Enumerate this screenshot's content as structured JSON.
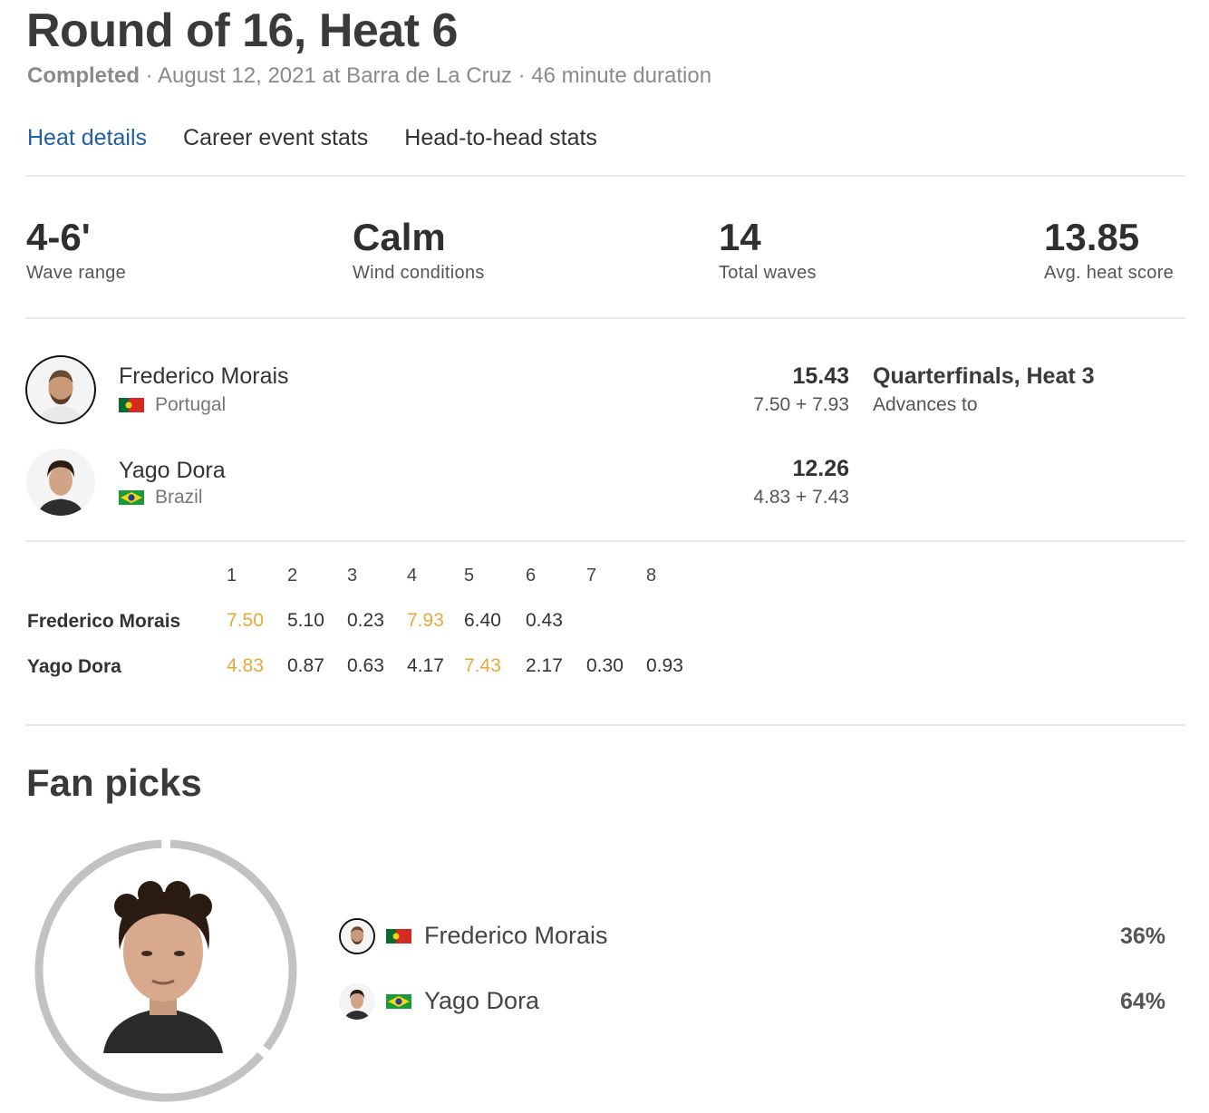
{
  "header": {
    "title": "Round of 16, Heat 6",
    "status": "Completed",
    "details": " · August 12, 2021 at Barra de La Cruz · 46 minute duration"
  },
  "tabs": [
    {
      "label": "Heat details",
      "active": true
    },
    {
      "label": "Career event stats",
      "active": false
    },
    {
      "label": "Head-to-head stats",
      "active": false
    }
  ],
  "stats": {
    "wave_range": {
      "value": "4-6'",
      "label": "Wave range"
    },
    "wind": {
      "value": "Calm",
      "label": "Wind conditions"
    },
    "total_waves": {
      "value": "14",
      "label": "Total waves"
    },
    "avg_score": {
      "value": "13.85",
      "label": "Avg. heat score"
    }
  },
  "athletes": [
    {
      "name": "Frederico Morais",
      "country": "Portugal",
      "flag": "portugal-flag",
      "total": "15.43",
      "breakdown": "7.50 + 7.93",
      "advances_title": "Quarterfinals, Heat 3",
      "advances_label": "Advances to"
    },
    {
      "name": "Yago Dora",
      "country": "Brazil",
      "flag": "brazil-flag",
      "total": "12.26",
      "breakdown": "4.83 + 7.43"
    }
  ],
  "waves": {
    "headers": [
      "1",
      "2",
      "3",
      "4",
      "5",
      "6",
      "7",
      "8"
    ],
    "rows": [
      {
        "name": "Frederico Morais",
        "scores": [
          "7.50",
          "5.10",
          "0.23",
          "7.93",
          "6.40",
          "0.43"
        ],
        "best": [
          0,
          3
        ]
      },
      {
        "name": "Yago Dora",
        "scores": [
          "4.83",
          "0.87",
          "0.63",
          "4.17",
          "7.43",
          "2.17",
          "0.30",
          "0.93"
        ],
        "best": [
          0,
          4
        ]
      }
    ]
  },
  "fan_picks": {
    "title": "Fan picks",
    "picks": [
      {
        "name": "Frederico Morais",
        "pct": "36%",
        "value": 36
      },
      {
        "name": "Yago Dora",
        "pct": "64%",
        "value": 64
      }
    ]
  },
  "colors": {
    "accent": "#1f5fa3",
    "best_wave": "#e9a93a",
    "ring": "#c2c2c2"
  }
}
